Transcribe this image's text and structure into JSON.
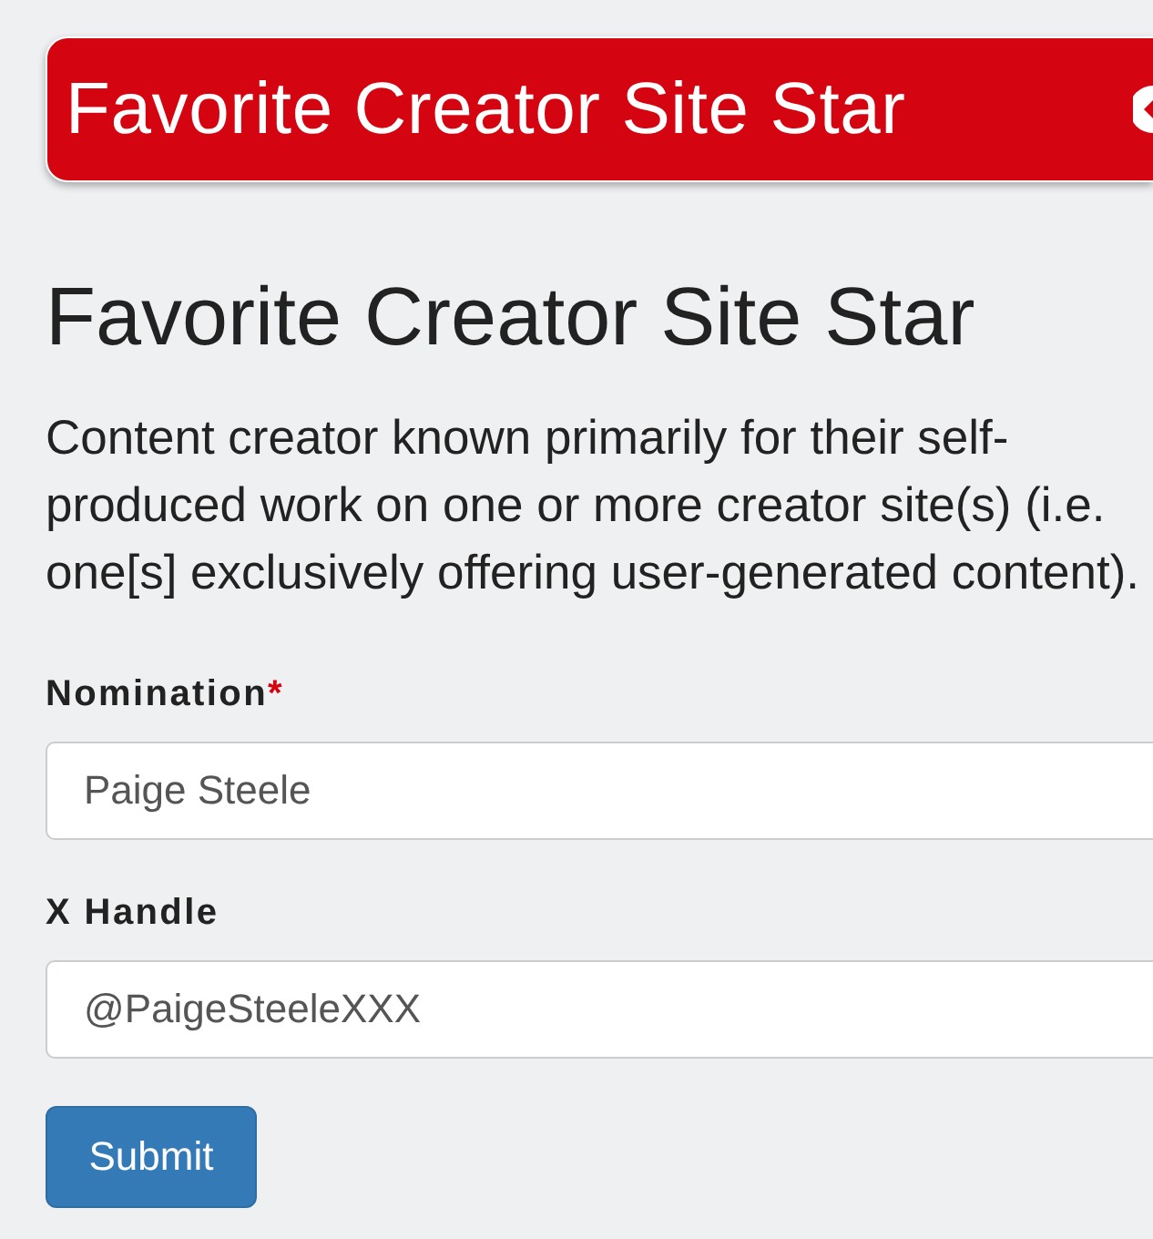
{
  "banner": {
    "title": "Favorite Creator Site Star"
  },
  "heading": "Favorite Creator Site Star",
  "description": "Content creator known primarily for their self-produced work on one or more creator site(s) (i.e. one[s] exclusively offering user-generated content).",
  "fields": [
    {
      "label": "Nomination",
      "required_mark": "*",
      "value": "Paige Steele"
    },
    {
      "label": "X Handle",
      "value": "@PaigeSteeleXXX"
    }
  ],
  "submit_button": "Submit"
}
